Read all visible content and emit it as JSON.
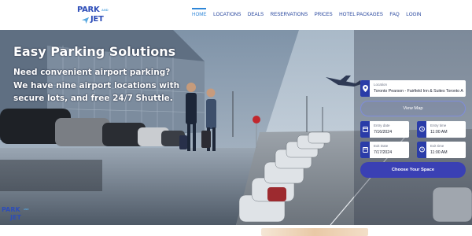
{
  "brand": {
    "logo_top": "PARK",
    "logo_small": "AND",
    "logo_bottom": "JET"
  },
  "nav": {
    "items": [
      {
        "label": "HOME",
        "active": true
      },
      {
        "label": "LOCATIONS"
      },
      {
        "label": "DEALS"
      },
      {
        "label": "RESERVATIONS"
      },
      {
        "label": "PRICES"
      },
      {
        "label": "HOTEL PACKAGES"
      },
      {
        "label": "FAQ"
      },
      {
        "label": "LOGIN"
      }
    ]
  },
  "hero": {
    "title": "Easy Parking Solutions",
    "subtitle": "Need convenient airport parking? We have nine airport locations with secure lots, and free 24/7 Shuttle."
  },
  "booking": {
    "location_label": "Location",
    "location_value": "Toronto Pearson - Fairfield Inn & Suites Toronto Airport",
    "view_map_label": "View Map",
    "entry_date_label": "Entry date",
    "entry_date_value": "7/16/2024",
    "entry_time_label": "Entry time",
    "entry_time_value": "11:00 AM",
    "exit_date_label": "Exit Date",
    "exit_date_value": "7/17/2024",
    "exit_time_label": "Exit time",
    "exit_time_value": "11:00 AM",
    "submit_label": "Choose Your Space"
  },
  "icons": [
    "location-pin-icon",
    "calendar-icon",
    "clock-icon",
    "plane-icon"
  ],
  "colors": {
    "brand_blue": "#2d4db8",
    "nav_text": "#1f3f9a",
    "nav_active": "#2e86d8",
    "form_accent": "#2a3ca8",
    "cta": "#3a40b4"
  }
}
